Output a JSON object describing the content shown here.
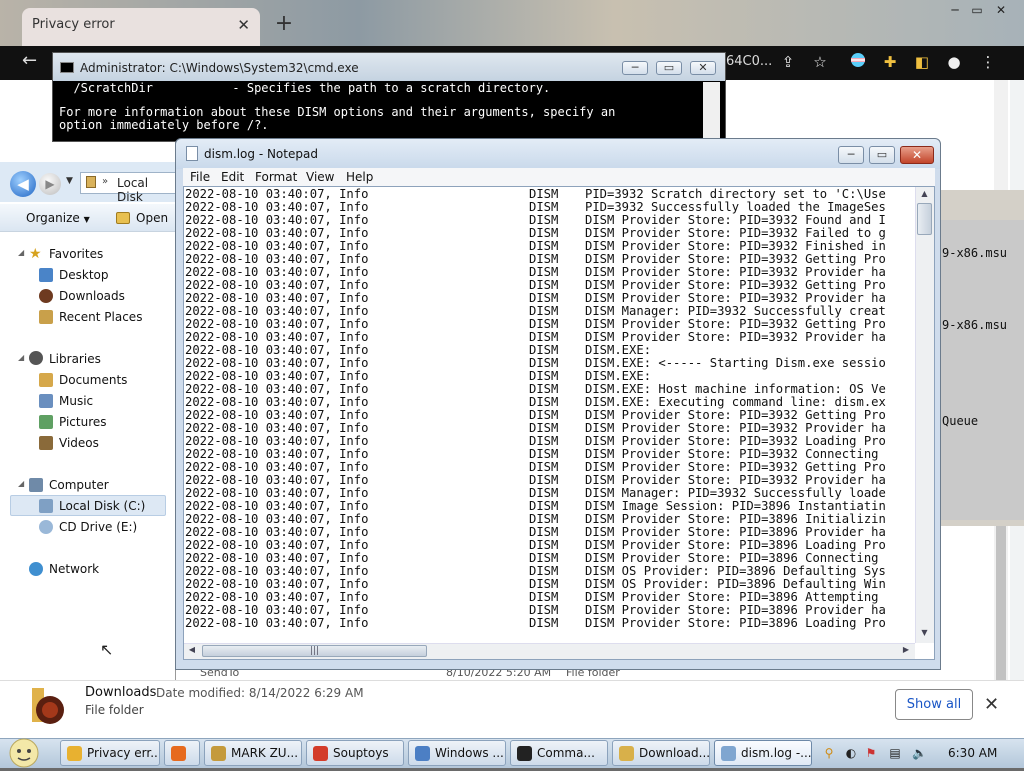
{
  "chrome": {
    "tab_title": "Privacy error",
    "tab_close": "✕",
    "new_tab": "+",
    "url_tail": "64C0...",
    "window_controls": [
      "─",
      "▭",
      "✕"
    ],
    "show_all": "Show all",
    "downloads_close": "✕"
  },
  "cmd": {
    "title": "Administrator: C:\\Windows\\System32\\cmd.exe",
    "lines": [
      "  /ScratchDir           - Specifies the path to a scratch directory.",
      "",
      "For more information about these DISM options and their arguments, specify an",
      "option immediately before /?."
    ]
  },
  "explorer": {
    "path": "Local Disk",
    "organize": "Organize",
    "open": "Open",
    "nav": {
      "favorites": "Favorites",
      "desktop": "Desktop",
      "downloads": "Downloads",
      "recent": "Recent Places",
      "libraries": "Libraries",
      "documents": "Documents",
      "music": "Music",
      "pictures": "Pictures",
      "videos": "Videos",
      "computer": "Computer",
      "local_disk": "Local Disk (C:)",
      "cd_drive": "CD Drive (E:)",
      "network": "Network"
    },
    "details": {
      "name": "Downloads",
      "date_modified": "Date modified: 8/14/2022 6:29 AM",
      "type": "File folder"
    },
    "sendto_row": {
      "name": "SendTo",
      "date": "8/10/2022 5:20 AM",
      "type": "File folder"
    }
  },
  "right_console": {
    "lines": [
      "9-x86.msu",
      "9-x86.msu",
      "Queue"
    ]
  },
  "notepad": {
    "title": "dism.log - Notepad",
    "menu": [
      "File",
      "Edit",
      "Format",
      "View",
      "Help"
    ],
    "log_lines": [
      [
        "2022-08-10 03:40:07, Info",
        "DISM",
        "PID=3932 Scratch directory set to 'C:\\Use"
      ],
      [
        "2022-08-10 03:40:07, Info",
        "DISM",
        "PID=3932 Successfully loaded the ImageSes"
      ],
      [
        "2022-08-10 03:40:07, Info",
        "DISM",
        "DISM Provider Store: PID=3932 Found and I"
      ],
      [
        "2022-08-10 03:40:07, Info",
        "DISM",
        "DISM Provider Store: PID=3932 Failed to g"
      ],
      [
        "2022-08-10 03:40:07, Info",
        "DISM",
        "DISM Provider Store: PID=3932 Finished in"
      ],
      [
        "2022-08-10 03:40:07, Info",
        "DISM",
        "DISM Provider Store: PID=3932 Getting Pro"
      ],
      [
        "2022-08-10 03:40:07, Info",
        "DISM",
        "DISM Provider Store: PID=3932 Provider ha"
      ],
      [
        "2022-08-10 03:40:07, Info",
        "DISM",
        "DISM Provider Store: PID=3932 Getting Pro"
      ],
      [
        "2022-08-10 03:40:07, Info",
        "DISM",
        "DISM Provider Store: PID=3932 Provider ha"
      ],
      [
        "2022-08-10 03:40:07, Info",
        "DISM",
        "DISM Manager: PID=3932 Successfully creat"
      ],
      [
        "2022-08-10 03:40:07, Info",
        "DISM",
        "DISM Provider Store: PID=3932 Getting Pro"
      ],
      [
        "2022-08-10 03:40:07, Info",
        "DISM",
        "DISM Provider Store: PID=3932 Provider ha"
      ],
      [
        "2022-08-10 03:40:07, Info",
        "DISM",
        "DISM.EXE:"
      ],
      [
        "2022-08-10 03:40:07, Info",
        "DISM",
        "DISM.EXE: <----- Starting Dism.exe sessio"
      ],
      [
        "2022-08-10 03:40:07, Info",
        "DISM",
        "DISM.EXE:"
      ],
      [
        "2022-08-10 03:40:07, Info",
        "DISM",
        "DISM.EXE: Host machine information: OS Ve"
      ],
      [
        "2022-08-10 03:40:07, Info",
        "DISM",
        "DISM.EXE: Executing command line: dism.ex"
      ],
      [
        "2022-08-10 03:40:07, Info",
        "DISM",
        "DISM Provider Store: PID=3932 Getting Pro"
      ],
      [
        "2022-08-10 03:40:07, Info",
        "DISM",
        "DISM Provider Store: PID=3932 Provider ha"
      ],
      [
        "2022-08-10 03:40:07, Info",
        "DISM",
        "DISM Provider Store: PID=3932 Loading Pro"
      ],
      [
        "2022-08-10 03:40:07, Info",
        "DISM",
        "DISM Provider Store: PID=3932 Connecting"
      ],
      [
        "2022-08-10 03:40:07, Info",
        "DISM",
        "DISM Provider Store: PID=3932 Getting Pro"
      ],
      [
        "2022-08-10 03:40:07, Info",
        "DISM",
        "DISM Provider Store: PID=3932 Provider ha"
      ],
      [
        "2022-08-10 03:40:07, Info",
        "DISM",
        "DISM Manager: PID=3932 Successfully loade"
      ],
      [
        "2022-08-10 03:40:07, Info",
        "DISM",
        "DISM Image Session: PID=3896 Instantiatin"
      ],
      [
        "2022-08-10 03:40:07, Info",
        "DISM",
        "DISM Provider Store: PID=3896 Initializin"
      ],
      [
        "2022-08-10 03:40:07, Info",
        "DISM",
        "DISM Provider Store: PID=3896 Provider ha"
      ],
      [
        "2022-08-10 03:40:07, Info",
        "DISM",
        "DISM Provider Store: PID=3896 Loading Pro"
      ],
      [
        "2022-08-10 03:40:07, Info",
        "DISM",
        "DISM Provider Store: PID=3896 Connecting"
      ],
      [
        "2022-08-10 03:40:07, Info",
        "DISM",
        "DISM OS Provider: PID=3896 Defaulting Sys"
      ],
      [
        "2022-08-10 03:40:07, Info",
        "DISM",
        "DISM OS Provider: PID=3896 Defaulting Win"
      ],
      [
        "2022-08-10 03:40:07, Info",
        "DISM",
        "DISM Provider Store: PID=3896 Attempting"
      ],
      [
        "2022-08-10 03:40:07, Info",
        "DISM",
        "DISM Provider Store: PID=3896 Provider ha"
      ],
      [
        "2022-08-10 03:40:07, Info",
        "DISM",
        "DISM Provider Store: PID=3896 Loading Pro"
      ]
    ]
  },
  "taskbar": {
    "tasks": [
      {
        "label": "Privacy err...",
        "icon_color": "#e8b130"
      },
      {
        "label": "",
        "icon_color": "#e66a1e"
      },
      {
        "label": "MARK ZU...",
        "icon_color": "#c49a3c"
      },
      {
        "label": "Souptoys",
        "icon_color": "#d33c2a"
      },
      {
        "label": "Windows ...",
        "icon_color": "#4c7fc4"
      },
      {
        "label": "Comma...",
        "icon_color": "#222222"
      },
      {
        "label": "Download...",
        "icon_color": "#d8b04a"
      },
      {
        "label": "dism.log -...",
        "icon_color": "#7fa6d0"
      }
    ],
    "clock": "6:30 AM"
  }
}
